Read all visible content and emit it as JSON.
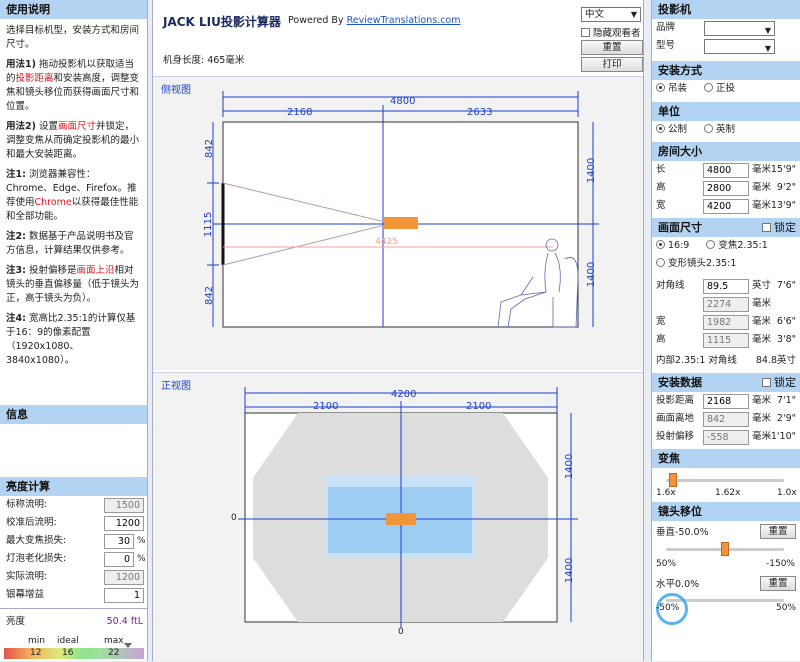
{
  "left": {
    "usage_header": "使用说明",
    "usage_intro": "选择目标机型，安装方式和房间尺寸。",
    "usage1_label": "用法1)",
    "usage1_a": " 拖动投影机以获取适当的",
    "usage1_red": "投影距离",
    "usage1_b": "和安装高度，调整变焦和镜头移位而获得画面尺寸和位置。",
    "usage2_label": "用法2)",
    "usage2_a": " 设置",
    "usage2_red": "画面尺寸",
    "usage2_b": "并锁定，调整变焦从而确定投影机的最小和最大安装距离。",
    "note1_label": "注1:",
    "note1_a": " 浏览器兼容性：Chrome、Edge、Firefox。推荐使用",
    "note1_red": "Chrome",
    "note1_b": "以获得最佳性能和全部功能。",
    "note2_label": "注2:",
    "note2_a": " 数据基于产品说明书及官方信息，计算结果仅供参考。",
    "note3_label": "注3:",
    "note3_a": " 投射偏移是",
    "note3_red": "画面上沿",
    "note3_b": "相对镜头的垂直偏移量（低于镜头为正，高于镜头为负）。",
    "note4_label": "注4:",
    "note4_a": " 宽高比2.35:1的计算仅基于16：9的像素配置（1920x1080、3840x1080）。",
    "info_header": "信息",
    "brightness_header": "亮度计算",
    "rows": [
      {
        "label": "标称流明:",
        "value": "1500"
      },
      {
        "label": "校准后流明:",
        "value": "1200"
      },
      {
        "label": "最大变焦损失:",
        "value": "30"
      },
      {
        "label": "灯泡老化损失:",
        "value": "0"
      },
      {
        "label": "实际流明:",
        "value": "1200"
      },
      {
        "label": "银幕增益",
        "value": "1"
      }
    ],
    "pct": "%",
    "brightness_label": "亮度",
    "brightness_value": "50.4 ftL",
    "scale_labels": [
      "min",
      "ideal",
      "max"
    ],
    "scale_values": [
      "12",
      "16",
      "22"
    ]
  },
  "center": {
    "title": "JACK LIU投影计算器",
    "powered_by": "Powered By ",
    "powered_link": "ReviewTranslations.com",
    "lang": "中文",
    "hide_viewer": "隐藏观看者",
    "reset": "重置",
    "print": "打印",
    "body_length": "机身长度: 465毫米",
    "side_title": "侧视图",
    "front_title": "正视图",
    "side": {
      "total": "4800",
      "left": "2168",
      "right": "2633",
      "top_h": "842",
      "screen_h": "1115",
      "bottom_h": "842",
      "right_top": "1400",
      "right_bottom": "1400",
      "throw": "4425"
    },
    "front": {
      "total": "4200",
      "left": "2100",
      "right": "2100",
      "right_top": "1400",
      "right_bottom": "1400",
      "zero_left": "0",
      "zero_bottom": "0"
    }
  },
  "right": {
    "projector_header": "投影机",
    "brand_label": "品牌",
    "model_label": "型号",
    "install_header": "安装方式",
    "install_options": [
      "吊装",
      "正投"
    ],
    "unit_header": "单位",
    "unit_options": [
      "公制",
      "英制"
    ],
    "room_header": "房间大小",
    "room_rows": [
      {
        "label": "长",
        "value": "4800",
        "unit": "毫米",
        "imp": "15'9\""
      },
      {
        "label": "高",
        "value": "2800",
        "unit": "毫米",
        "imp": "9'2\""
      },
      {
        "label": "宽",
        "value": "4200",
        "unit": "毫米",
        "imp": "13'9\""
      }
    ],
    "screen_header": "画面尺寸",
    "lock": "锁定",
    "aspect_options": [
      "16:9",
      "变焦2.35:1",
      "变形镜头2.35:1"
    ],
    "screen_rows": [
      {
        "label": "对角线",
        "value": "89.5",
        "unit": "英寸",
        "imp": "7'6\"",
        "dis": false
      },
      {
        "label": "",
        "value": "2274",
        "unit": "毫米",
        "imp": "",
        "dis": true
      },
      {
        "label": "宽",
        "value": "1982",
        "unit": "毫米",
        "imp": "6'6\"",
        "dis": true
      },
      {
        "label": "高",
        "value": "1115",
        "unit": "毫米",
        "imp": "3'8\"",
        "dis": true
      }
    ],
    "inner_label": "内部2.35:1 对角线",
    "inner_value": "84.8英寸",
    "mount_header": "安装数据",
    "mount_rows": [
      {
        "label": "投影距离",
        "value": "2168",
        "unit": "毫米",
        "imp": "7'1\"",
        "dis": false
      },
      {
        "label": "画面离地",
        "value": "842",
        "unit": "毫米",
        "imp": "2'9\"",
        "dis": true
      },
      {
        "label": "投射偏移",
        "value": "-558",
        "unit": "毫米",
        "imp": "-1'10\"",
        "dis": true
      }
    ],
    "zoom_header": "变焦",
    "zoom_ticks": [
      "1.6x",
      "1.62x",
      "1.0x"
    ],
    "shift_header": "镜头移位",
    "vertical_label": "垂直-50.0%",
    "reset": "重置",
    "shift_ticks": [
      "50%",
      "-150%"
    ],
    "horizontal_label": "水平0.0%",
    "h_ticks": [
      "-50%",
      "50%"
    ]
  }
}
